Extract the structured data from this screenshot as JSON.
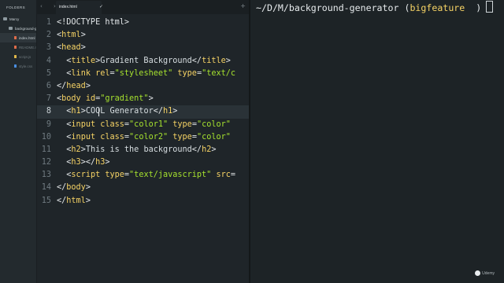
{
  "sidebar": {
    "header": "FOLDERS",
    "items": [
      {
        "label": "Marcy",
        "type": "folder",
        "indent": 0
      },
      {
        "label": "background-generator",
        "type": "folder",
        "indent": 1
      },
      {
        "label": "index.html",
        "type": "file",
        "indent": 2,
        "selected": true,
        "color": "#e06c4a"
      },
      {
        "label": "README.md",
        "type": "file",
        "indent": 2,
        "color": "#e06c4a"
      },
      {
        "label": "script.js",
        "type": "file",
        "indent": 2,
        "color": "#e0b84a"
      },
      {
        "label": "style.css",
        "type": "file",
        "indent": 2,
        "color": "#4a8ee0"
      }
    ]
  },
  "editor": {
    "nav_arrows": "‹ ›",
    "tab_label": "index.html",
    "tab_check": "✓",
    "tab_add": "+",
    "highlight_line": 8,
    "lines": [
      {
        "num": "1",
        "parts": [
          [
            "doctype",
            "<!DOCTYPE html>"
          ]
        ]
      },
      {
        "num": "2",
        "parts": [
          [
            "tag",
            "<"
          ],
          [
            "tname",
            "html"
          ],
          [
            "tag",
            ">"
          ]
        ]
      },
      {
        "num": "3",
        "parts": [
          [
            "tag",
            "<"
          ],
          [
            "tname",
            "head"
          ],
          [
            "tag",
            ">"
          ]
        ]
      },
      {
        "num": "4",
        "parts": [
          [
            "plain",
            "  "
          ],
          [
            "tag",
            "<"
          ],
          [
            "tname",
            "title"
          ],
          [
            "tag",
            ">"
          ],
          [
            "plain",
            "Gradient Background"
          ],
          [
            "tag",
            "</"
          ],
          [
            "tname",
            "title"
          ],
          [
            "tag",
            ">"
          ]
        ]
      },
      {
        "num": "5",
        "parts": [
          [
            "plain",
            "  "
          ],
          [
            "tag",
            "<"
          ],
          [
            "tname",
            "link "
          ],
          [
            "attr",
            "rel"
          ],
          [
            "tag",
            "="
          ],
          [
            "str",
            "\"stylesheet\""
          ],
          [
            "plain",
            " "
          ],
          [
            "attr",
            "type"
          ],
          [
            "tag",
            "="
          ],
          [
            "str",
            "\"text/c"
          ]
        ]
      },
      {
        "num": "6",
        "parts": [
          [
            "tag",
            "</"
          ],
          [
            "tname",
            "head"
          ],
          [
            "tag",
            ">"
          ]
        ]
      },
      {
        "num": "7",
        "parts": [
          [
            "tag",
            "<"
          ],
          [
            "tname",
            "body "
          ],
          [
            "attr",
            "id"
          ],
          [
            "tag",
            "="
          ],
          [
            "str",
            "\"gradient\""
          ],
          [
            "tag",
            ">"
          ]
        ]
      },
      {
        "num": "8",
        "parts": [
          [
            "plain",
            "  "
          ],
          [
            "tag",
            "<"
          ],
          [
            "tname",
            "h1"
          ],
          [
            "tag",
            ">"
          ],
          [
            "plain",
            "COOL Generator"
          ],
          [
            "tag",
            "</"
          ],
          [
            "tname",
            "h1"
          ],
          [
            "tag",
            ">"
          ]
        ]
      },
      {
        "num": "9",
        "parts": [
          [
            "plain",
            "  "
          ],
          [
            "tag",
            "<"
          ],
          [
            "tname",
            "input "
          ],
          [
            "attr",
            "class"
          ],
          [
            "tag",
            "="
          ],
          [
            "str",
            "\"color1\""
          ],
          [
            "plain",
            " "
          ],
          [
            "attr",
            "type"
          ],
          [
            "tag",
            "="
          ],
          [
            "str",
            "\"color\""
          ]
        ]
      },
      {
        "num": "10",
        "parts": [
          [
            "plain",
            "  "
          ],
          [
            "tag",
            "<"
          ],
          [
            "tname",
            "input "
          ],
          [
            "attr",
            "class"
          ],
          [
            "tag",
            "="
          ],
          [
            "str",
            "\"color2\""
          ],
          [
            "plain",
            " "
          ],
          [
            "attr",
            "type"
          ],
          [
            "tag",
            "="
          ],
          [
            "str",
            "\"color\""
          ]
        ]
      },
      {
        "num": "11",
        "parts": [
          [
            "plain",
            "  "
          ],
          [
            "tag",
            "<"
          ],
          [
            "tname",
            "h2"
          ],
          [
            "tag",
            ">"
          ],
          [
            "plain",
            "This is the background"
          ],
          [
            "tag",
            "</"
          ],
          [
            "tname",
            "h2"
          ],
          [
            "tag",
            ">"
          ]
        ]
      },
      {
        "num": "12",
        "parts": [
          [
            "plain",
            "  "
          ],
          [
            "tag",
            "<"
          ],
          [
            "tname",
            "h3"
          ],
          [
            "tag",
            "></"
          ],
          [
            "tname",
            "h3"
          ],
          [
            "tag",
            ">"
          ]
        ]
      },
      {
        "num": "13",
        "parts": [
          [
            "plain",
            "  "
          ],
          [
            "tag",
            "<"
          ],
          [
            "tname",
            "script "
          ],
          [
            "attr",
            "type"
          ],
          [
            "tag",
            "="
          ],
          [
            "str",
            "\"text/javascript\""
          ],
          [
            "plain",
            " "
          ],
          [
            "attr",
            "src"
          ],
          [
            "tag",
            "="
          ]
        ]
      },
      {
        "num": "14",
        "parts": [
          [
            "tag",
            "</"
          ],
          [
            "tname",
            "body"
          ],
          [
            "tag",
            ">"
          ]
        ]
      },
      {
        "num": "15",
        "parts": [
          [
            "tag",
            "</"
          ],
          [
            "tname",
            "html"
          ],
          [
            "tag",
            ">"
          ]
        ]
      }
    ]
  },
  "terminal": {
    "path": "~/D/M/background-generator",
    "branch_open": " (",
    "branch": "bigfeature",
    "branch_close": "  )"
  },
  "watermark": {
    "label": "Udemy"
  },
  "colors": {
    "tag_name": "#f6d365",
    "string": "#a6e22e",
    "background": "#1f2529"
  }
}
